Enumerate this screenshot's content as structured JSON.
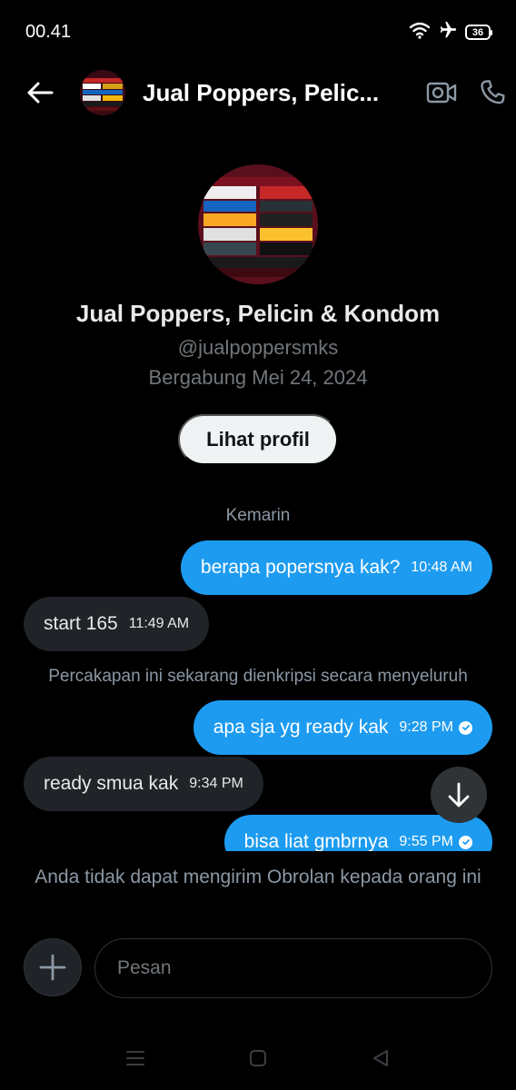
{
  "status_bar": {
    "time": "00.41",
    "icons": [
      "wifi-icon",
      "airplane-icon",
      "battery-icon"
    ],
    "battery_level": "36"
  },
  "header": {
    "title": "Jual Poppers, Pelic...",
    "back_icon": "arrow-left-icon",
    "video_icon": "video-camera-icon",
    "call_icon": "phone-icon"
  },
  "profile": {
    "name": "Jual Poppers, Pelicin & Kondom",
    "handle": "@jualpoppersmks",
    "joined": "Bergabung Mei 24, 2024",
    "view_profile_label": "Lihat profil"
  },
  "conversation": {
    "day_separator": "Kemarin",
    "encryption_note": "Percakapan ini sekarang dienkripsi secara menyeluruh",
    "messages": [
      {
        "direction": "out",
        "text": "berapa popersnya kak?",
        "time": "10:48 AM",
        "read": false
      },
      {
        "direction": "in",
        "text": "start 165",
        "time": "11:49 AM"
      },
      {
        "direction": "out",
        "text": "apa sja yg ready kak",
        "time": "9:28 PM",
        "read": true
      },
      {
        "direction": "in",
        "text": "ready smua kak",
        "time": "9:34 PM"
      },
      {
        "direction": "out",
        "text": "bisa liat gmbrnya",
        "time": "9:55 PM",
        "read": true
      }
    ]
  },
  "notice": {
    "cannot_send": "Anda tidak dapat mengirim Obrolan kepada orang ini"
  },
  "composer": {
    "placeholder": "Pesan",
    "add_icon": "plus-icon"
  },
  "colors": {
    "background": "#000000",
    "outgoing_bubble": "#1d9bf0",
    "incoming_bubble": "#202327",
    "secondary_text": "#71767b"
  }
}
